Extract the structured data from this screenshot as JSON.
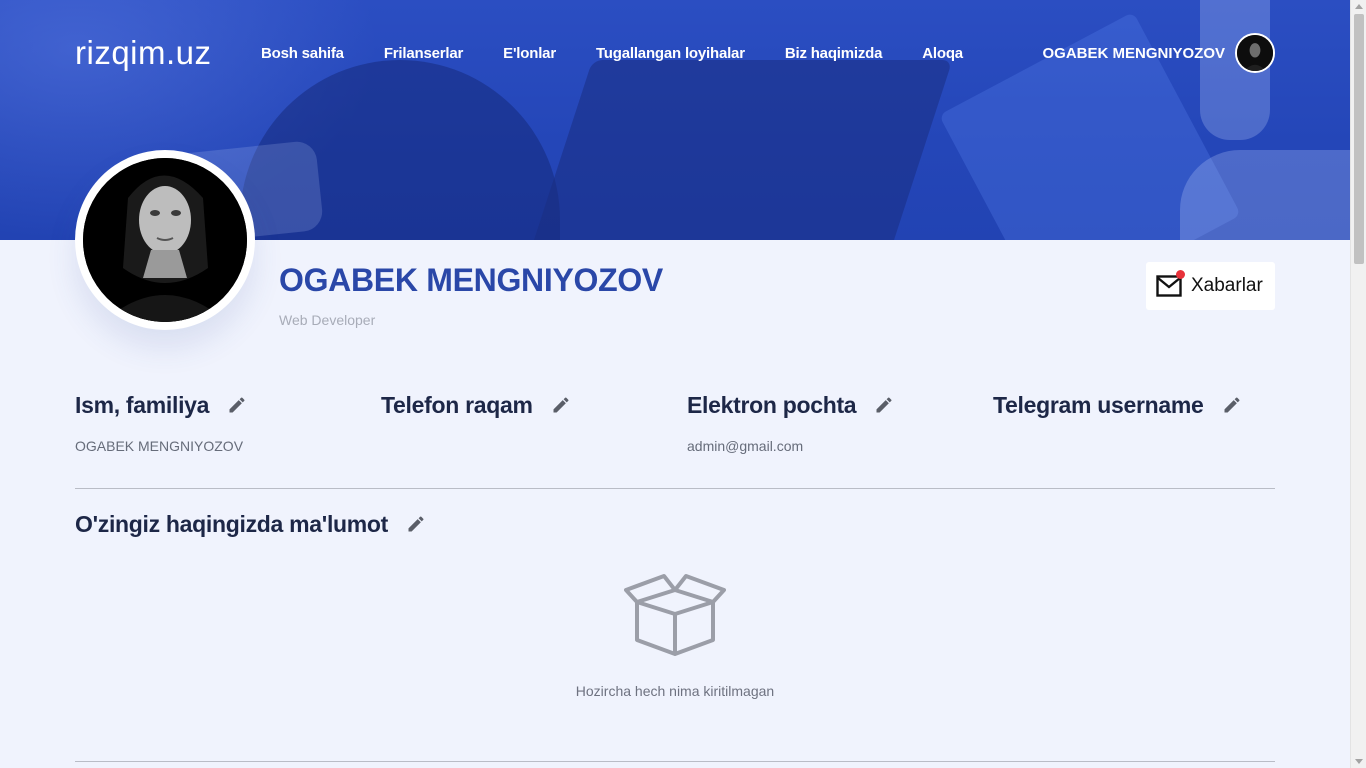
{
  "brand": {
    "logo": "rizqim.uz"
  },
  "nav": {
    "items": [
      {
        "label": "Bosh sahifa"
      },
      {
        "label": "Frilanserlar"
      },
      {
        "label": "E'lonlar"
      },
      {
        "label": "Tugallangan loyihalar"
      },
      {
        "label": "Biz haqimizda"
      },
      {
        "label": "Aloqa"
      }
    ],
    "user_name": "OGABEK MENGNIYOZOV"
  },
  "profile": {
    "name": "OGABEK MENGNIYOZOV",
    "role": "Web Developer",
    "messages_label": "Xabarlar",
    "has_unread": true
  },
  "fields": [
    {
      "title": "Ism, familiya",
      "value": "OGABEK MENGNIYOZOV"
    },
    {
      "title": "Telefon raqam",
      "value": ""
    },
    {
      "title": "Elektron pochta",
      "value": "admin@gmail.com"
    },
    {
      "title": "Telegram username",
      "value": ""
    }
  ],
  "about": {
    "title": "O'zingiz haqingizda ma'lumot",
    "empty_text": "Hozircha hech nima kiritilmagan"
  },
  "colors": {
    "hero_blue": "#2446b8",
    "name_blue": "#2a47a8",
    "heading_dark": "#1d2747",
    "unread_dot": "#e8323a",
    "background": "#f0f3fd"
  },
  "icons": {
    "edit": "pencil-icon",
    "messages": "mail-icon",
    "empty": "open-box-icon"
  }
}
